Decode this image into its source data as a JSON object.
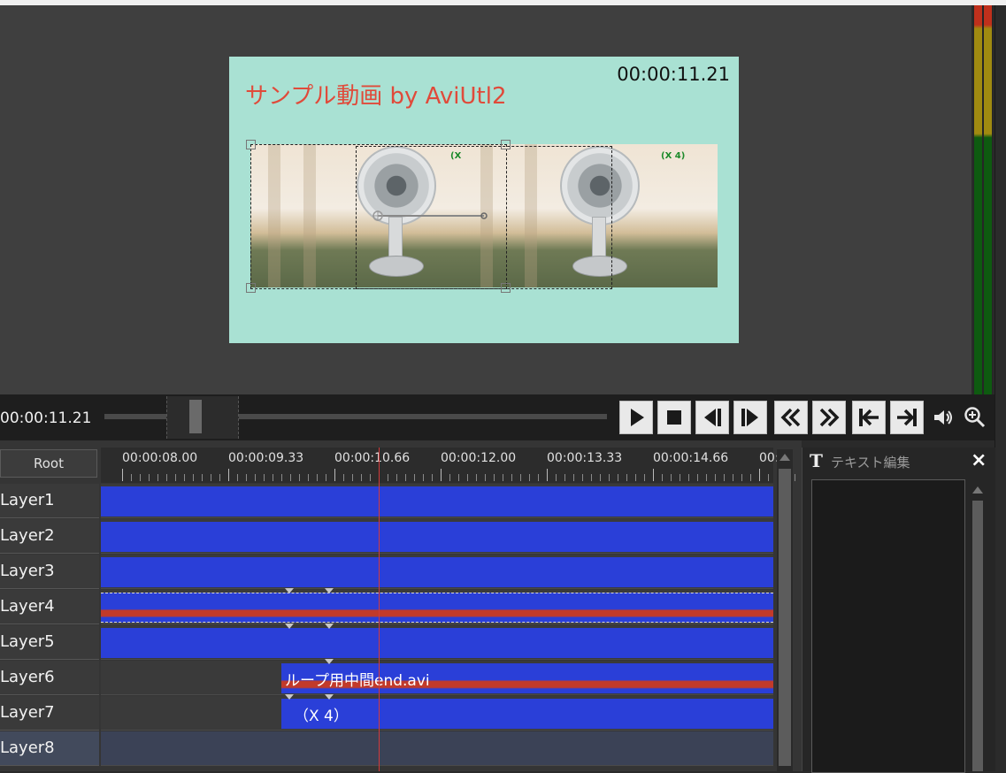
{
  "preview": {
    "canvas_title": "サンプル動画 by AviUtl2",
    "canvas_time": "00:00:11.21",
    "clip_tag_left": "(X",
    "clip_tag_right": "(X 4)"
  },
  "transport": {
    "current_time": "00:00:11.21",
    "buttons": [
      "play",
      "stop",
      "prev-frame",
      "next-frame",
      "rewind",
      "fast-forward",
      "go-to-start",
      "go-to-end"
    ],
    "icons": [
      "volume",
      "zoom"
    ]
  },
  "timeline": {
    "root_label": "Root",
    "ruler_labels": [
      "00:00:08.00",
      "00:00:09.33",
      "00:00:10.66",
      "00:00:12.00",
      "00:00:13.33",
      "00:00:14.66",
      "00:0"
    ],
    "layers": [
      {
        "label": "Layer1"
      },
      {
        "label": "Layer2"
      },
      {
        "label": "Layer3"
      },
      {
        "label": "Layer4"
      },
      {
        "label": "Layer5"
      },
      {
        "label": "Layer6"
      },
      {
        "label": "Layer7"
      },
      {
        "label": "Layer8"
      }
    ],
    "clip_layer6_label": "ループ用中間end.avi",
    "clip_layer7_label": "（X 4）"
  },
  "text_panel": {
    "title": "テキスト編集",
    "title_icon": "T",
    "close_icon": "×"
  },
  "colors": {
    "canvas_bg": "#a9e1d3",
    "title_red": "#e04a3a",
    "clip_blue": "#2a3fd8",
    "audio_red": "#c23a2a",
    "playhead": "#d23a3a"
  }
}
